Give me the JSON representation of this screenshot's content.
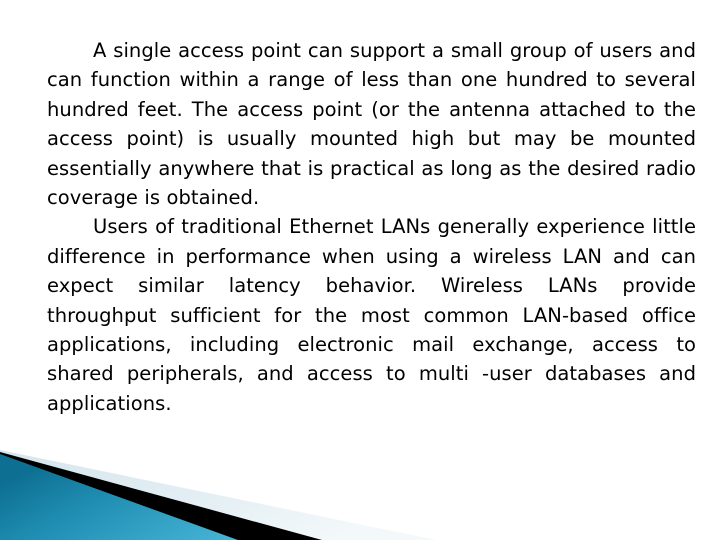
{
  "slide": {
    "kind": "presentation-slide",
    "background_color": "#ffffff",
    "text_color": "#000000",
    "paragraphs": [
      {
        "id": "paragraph-1",
        "text": "A single access point can support a small group of users and can function within a range of less than one hundred to several hundred feet. The access point (or the antenna attached to the access point) is usually mounted high but may be mounted essentially anywhere that is practical as long as the desired radio coverage is obtained."
      },
      {
        "id": "paragraph-2",
        "text": "Users of traditional Ethernet LANs generally experience little difference in performance when using a wireless LAN and can expect similar latency behavior. Wireless LANs provide throughput sufficient for the most common LAN-based office applications, including electronic mail exchange, access to shared peripherals, and access to multi -user databases and applications."
      }
    ]
  },
  "decoration": {
    "name": "diagonal-corner-bands",
    "colors": {
      "blue_dark": "#0d6f92",
      "blue_mid": "#2091b5",
      "blue_light": "#45b2d4",
      "black": "#000000",
      "pale_blue": "#dde9ef",
      "pale_blue_fade": "#eef4f7"
    }
  }
}
